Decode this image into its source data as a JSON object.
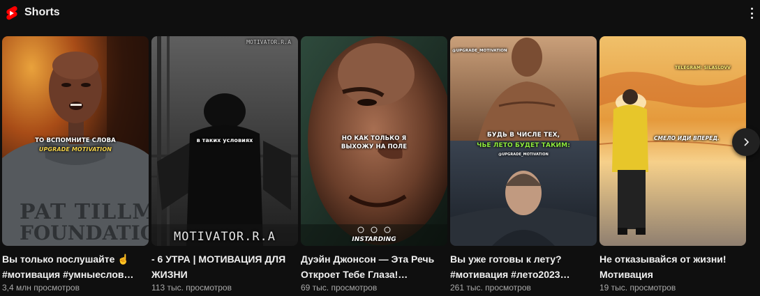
{
  "section": {
    "title": "Shorts",
    "logo_icon": "youtube-shorts-icon",
    "menu_icon": "more-vertical-icon",
    "accent": "#ff0000"
  },
  "shorts": [
    {
      "title": "Вы только послушайте ☝️ #мотивация #умныеслов…",
      "views": "3,4 млн просмотров",
      "overlay_text": "ТО ВСПОМНИТЕ СЛОВА",
      "overlay_logo": "UPGRADE MOTIVATION",
      "shirt_text": "PAT TILLMAN\nFOUNDATION"
    },
    {
      "title": "- 6 УТРА | МОТИВАЦИЯ ДЛЯ ЖИЗНИ",
      "views": "113 тыс. просмотров",
      "overlay_text": "в таких условиях",
      "watermark_top": "MOTIVATOR.R.A",
      "watermark_bottom": "MOTIVATOR.R.A"
    },
    {
      "title": "Дуэйн Джонсон — Эта Речь Откроет Тебе Глаза!…",
      "views": "69 тыс. просмотров",
      "overlay_text": "НО КАК ТОЛЬКО Я ВЫХОЖУ НА ПОЛЕ",
      "watermark": "INSTARDING"
    },
    {
      "title": "Вы уже готовы к лету? #мотивация #лето2023…",
      "views": "261 тыс. просмотров",
      "handle_top": "@UPGRADE_MOTIVATION",
      "overlay_line1": "БУДЬ В ЧИСЛЕ ТЕХ,",
      "overlay_line2": "ЧЬЕ ЛЕТО БУДЕТ ТАКИМ:",
      "handle_mid": "@UPGRADE_MOTIVATION"
    },
    {
      "title": "Не отказывайся от жизни! Мотивация",
      "views": "19 тыс. просмотров",
      "overlay_tag": "TELEGRAM: SILASLOVV",
      "overlay_text": "СМЕЛО ИДИ ВПЕРЕД."
    }
  ],
  "navigation": {
    "next_icon": "chevron-right-icon"
  }
}
